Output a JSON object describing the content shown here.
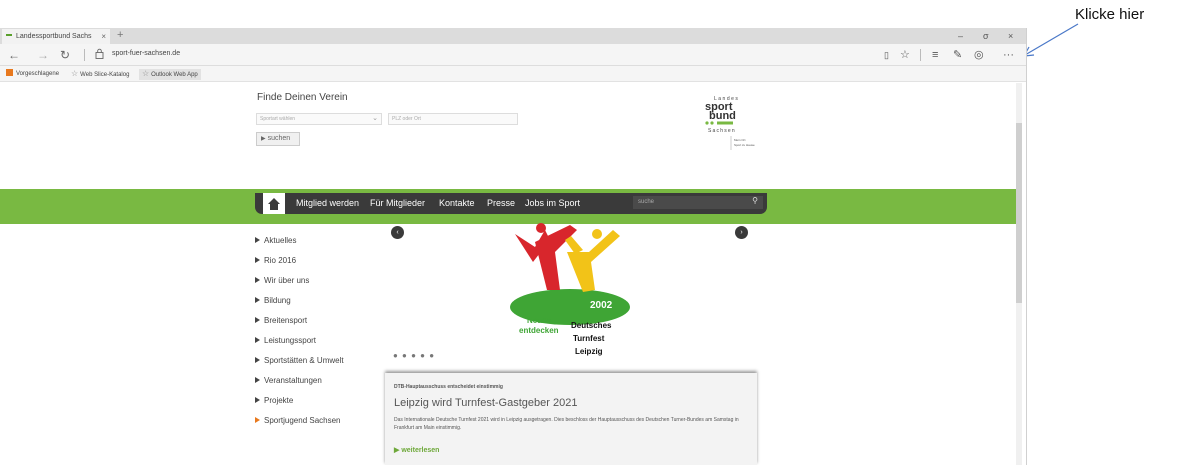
{
  "callout": {
    "text": "Klicke hier"
  },
  "browser": {
    "tab_title": "Landessportbund Sachs",
    "tab_close": "×",
    "new_tab": "+",
    "win_min": "–",
    "win_max": "σ",
    "win_close": "×",
    "url": "sport-fuer-sachsen.de",
    "favorites": [
      "Vorgeschlagene",
      "Web Slice-Katalog",
      "Outlook Web App"
    ],
    "icons": {
      "back": "arrow-left-icon",
      "forward": "arrow-right-icon",
      "refresh": "refresh-icon",
      "reading": "reading-view-icon",
      "favorite": "star-icon",
      "hub": "hub-icon",
      "notes": "web-note-icon",
      "share": "share-icon",
      "more": "more-icon"
    }
  },
  "search_section": {
    "title": "Finde Deinen Verein",
    "sport_placeholder": "Sportart wählen",
    "plz_placeholder": "PLZ oder Ort",
    "button": "suchen"
  },
  "logo": {
    "line1": "Landes",
    "line2": "sport",
    "line3": "bund",
    "line4": "Sachsen",
    "tagline1": "Mein Ort",
    "tagline2": "Sport zu Hause"
  },
  "nav": {
    "items": [
      "Mitglied werden",
      "Für Mitglieder",
      "Kontakte",
      "Presse",
      "Jobs im Sport"
    ],
    "search_placeholder": "suche"
  },
  "menu": {
    "items": [
      "Aktuelles",
      "Rio 2016",
      "Wir über uns",
      "Bildung",
      "Breitensport",
      "Leistungssport",
      "Sportstätten & Umwelt",
      "Veranstaltungen",
      "Projekte",
      "Sportjugend Sachsen"
    ]
  },
  "carousel": {
    "year": "2002",
    "line1": "Neues",
    "line2": "entdecken",
    "line3": "Deutsches",
    "line4": "Turnfest",
    "line5": "Leipzig",
    "prev": "‹",
    "next": "›",
    "dots": "● ● ● ● ●",
    "active_slide": 3,
    "slide_count": 5
  },
  "article": {
    "kicker": "DTB-Hauptausschuss entscheidet einstimmig",
    "title": "Leipzig wird Turnfest-Gastgeber 2021",
    "body": "Das Internationale Deutsche Turnfest 2021 wird in Leipzig ausgetragen. Dies beschloss der Hauptausschuss des Deutschen Turner-Bundes am Samstag in Frankfurt am Main einstimmig.",
    "more": "weiterlesen"
  },
  "colors": {
    "green": "#79b942",
    "dark": "#3a3a3a",
    "orange": "#e8791e",
    "red": "#d8262c",
    "yellow": "#f2c318"
  }
}
